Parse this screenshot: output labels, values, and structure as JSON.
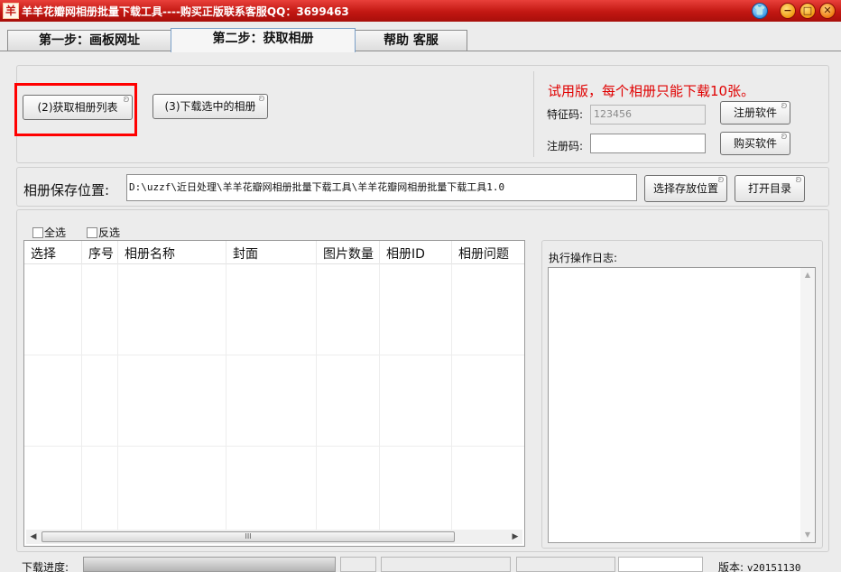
{
  "window": {
    "title": "羊羊花瓣网相册批量下载工具----购买正版联系客服QQ：3699463",
    "icon_char": "羊"
  },
  "tabs": [
    {
      "label": "第一步：画板网址"
    },
    {
      "label": "第二步：获取相册"
    },
    {
      "label": "帮助 客服"
    }
  ],
  "actions": {
    "fetch_list_label": "(2)获取相册列表",
    "download_selected_label": "(3)下载选中的相册"
  },
  "license": {
    "trial_notice": "试用版，每个相册只能下载10张。",
    "feature_code_label": "特征码:",
    "feature_code_value": "123456",
    "reg_code_label": "注册码:",
    "reg_code_value": "",
    "register_button": "注册软件",
    "buy_button": "购买软件"
  },
  "save": {
    "label": "相册保存位置:",
    "path": "D:\\uzzf\\近日处理\\羊羊花瓣网相册批量下载工具\\羊羊花瓣网相册批量下载工具1.0",
    "choose_button": "选择存放位置",
    "open_button": "打开目录"
  },
  "selection": {
    "select_all": "全选",
    "invert": "反选"
  },
  "table": {
    "columns": [
      "选择",
      "序号",
      "相册名称",
      "封面",
      "图片数量",
      "相册ID",
      "相册问题"
    ],
    "rows": []
  },
  "scrollbar": {
    "grip": "III"
  },
  "log": {
    "label": "执行操作日志:",
    "content": ""
  },
  "status": {
    "progress_label": "下载进度:",
    "progress_percent": 100,
    "version_label": "版本:",
    "version_value": "v20151130"
  },
  "icons": {
    "skin": "shirt-icon",
    "minimize": "minimize-icon",
    "maximize": "maximize-icon",
    "close": "close-icon"
  },
  "colors": {
    "titlebar": "#c21712",
    "trial_notice": "#e00000",
    "highlight": "#ff0000"
  }
}
